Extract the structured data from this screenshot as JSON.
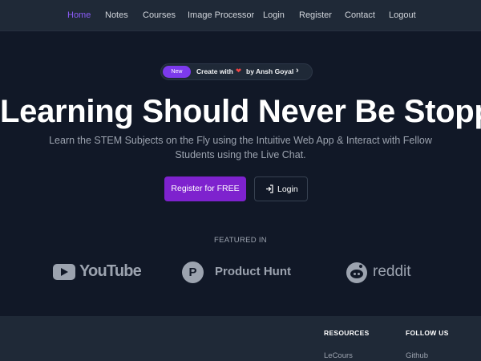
{
  "nav": {
    "items": [
      {
        "label": "Home",
        "active": true
      },
      {
        "label": "Notes"
      },
      {
        "label": "Courses"
      },
      {
        "label": "Image Processor"
      },
      {
        "label": "Login"
      },
      {
        "label": "Register"
      },
      {
        "label": "Contact"
      },
      {
        "label": "Logout"
      }
    ]
  },
  "announcement": {
    "badge": "New",
    "text_before": "Create with",
    "heart": "❤",
    "text_after": "by Ansh Goyal",
    "chevron": "›"
  },
  "hero": {
    "headline": "Learning Should Never Be Stopped!",
    "subtitle": "Learn the STEM Subjects on the Fly using the Intuitive Web App & Interact with Fellow Students using the Live Chat.",
    "primary_button": "Register for FREE",
    "secondary_button": "Login"
  },
  "featured": {
    "heading": "FEATURED IN",
    "logos": [
      {
        "name": "YouTube",
        "icon": "youtube-play-icon"
      },
      {
        "name": "Product Hunt",
        "icon": "product-hunt-p-icon",
        "icon_letter": "P"
      },
      {
        "name": "reddit",
        "icon": "reddit-alien-icon"
      }
    ]
  },
  "footer": {
    "resources": {
      "heading": "RESOURCES",
      "links": [
        "LeCours"
      ]
    },
    "follow": {
      "heading": "FOLLOW US",
      "links": [
        "Github"
      ]
    }
  },
  "colors": {
    "accent": "#8b5cf6",
    "primary_button": "#7e22ce",
    "background": "#111827",
    "nav_background": "#1f2937",
    "heart": "#ef4444"
  }
}
